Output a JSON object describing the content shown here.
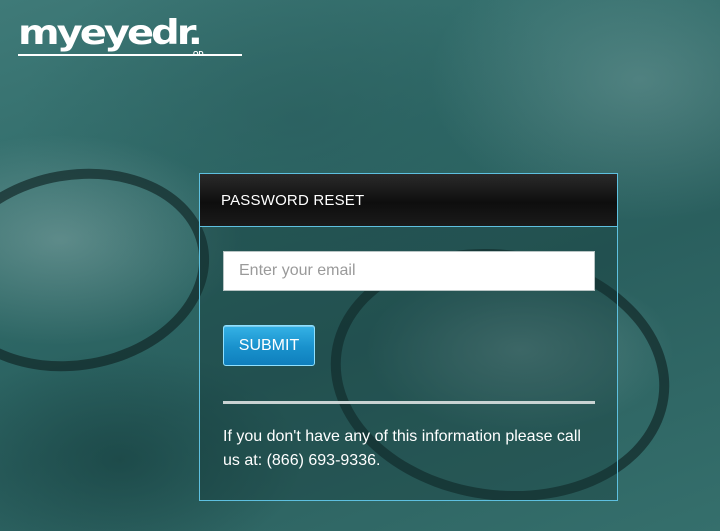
{
  "brand": {
    "logo_text": "myeyedr.",
    "logo_suffix": "OD"
  },
  "reset_panel": {
    "title": "PASSWORD RESET",
    "email_placeholder": "Enter your email",
    "email_value": "",
    "submit_label": "SUBMIT",
    "help_text": "If you don't have any of this information please call us at: (866) 693-9336."
  },
  "colors": {
    "accent_border": "#5ec0e0",
    "button_blue": "#1991cc",
    "header_black": "#0e0e0e",
    "background_teal": "#2e6967"
  }
}
